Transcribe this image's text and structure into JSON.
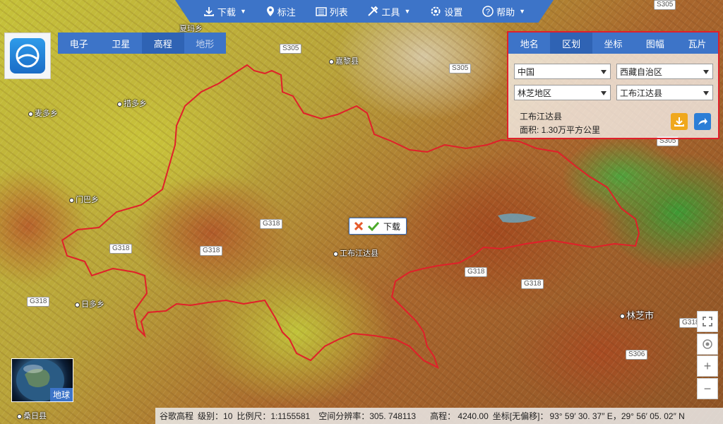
{
  "toolbar": {
    "items": [
      {
        "label": "下载",
        "icon": "download-icon",
        "has_dropdown": true
      },
      {
        "label": "标注",
        "icon": "pin-icon"
      },
      {
        "label": "列表",
        "icon": "list-icon"
      },
      {
        "label": "工具",
        "icon": "tools-icon",
        "has_dropdown": true
      },
      {
        "label": "设置",
        "icon": "gear-icon"
      },
      {
        "label": "帮助",
        "icon": "help-icon",
        "has_dropdown": true
      }
    ]
  },
  "map_types": [
    "电子",
    "卫星",
    "高程",
    "地形"
  ],
  "active_map_type": "高程",
  "panel": {
    "tabs": [
      "地名",
      "区划",
      "坐标",
      "图幅",
      "瓦片"
    ],
    "active_tab": "区划",
    "country": "中国",
    "province": "西藏自治区",
    "prefecture": "林芝地区",
    "county": "工布江达县",
    "result_name": "工布江达县",
    "result_area": "面积: 1.30万平方公里"
  },
  "popup": {
    "label": "下载"
  },
  "map": {
    "places": [
      {
        "name": "夏玛乡"
      },
      {
        "name": "嘉黎县"
      },
      {
        "name": "措多乡"
      },
      {
        "name": "麦多乡"
      },
      {
        "name": "门巴乡"
      },
      {
        "name": "工布江达县"
      },
      {
        "name": "日多乡"
      },
      {
        "name": "桑日县"
      }
    ],
    "city": "林芝市",
    "roads": [
      "S305",
      "S305",
      "S305",
      "G318",
      "G318",
      "G318",
      "G318",
      "G318",
      "G318",
      "G318",
      "S306",
      "S305"
    ],
    "boundary_color": "#e0202a"
  },
  "globe": {
    "label": "地球"
  },
  "zoom": {
    "fullscreen": "fullscreen-icon",
    "locate": "locate-icon",
    "zoom_in": "+",
    "zoom_out": "−"
  },
  "status": {
    "source": "谷歌高程",
    "level": "级别：10",
    "scale": "比例尺：1:1155581",
    "resolution": "空间分辨率：305. 748113",
    "elevation": "高程：  4240.00",
    "coord_label": "坐标[无偏移]：",
    "coord_value": "93° 59′ 30. 37″ E，29° 56′ 05. 02″ N"
  },
  "colors": {
    "accent": "#3d74c8",
    "boundary": "#e0202a",
    "download_btn": "#f0a81c",
    "share_btn": "#2c7ed6"
  }
}
